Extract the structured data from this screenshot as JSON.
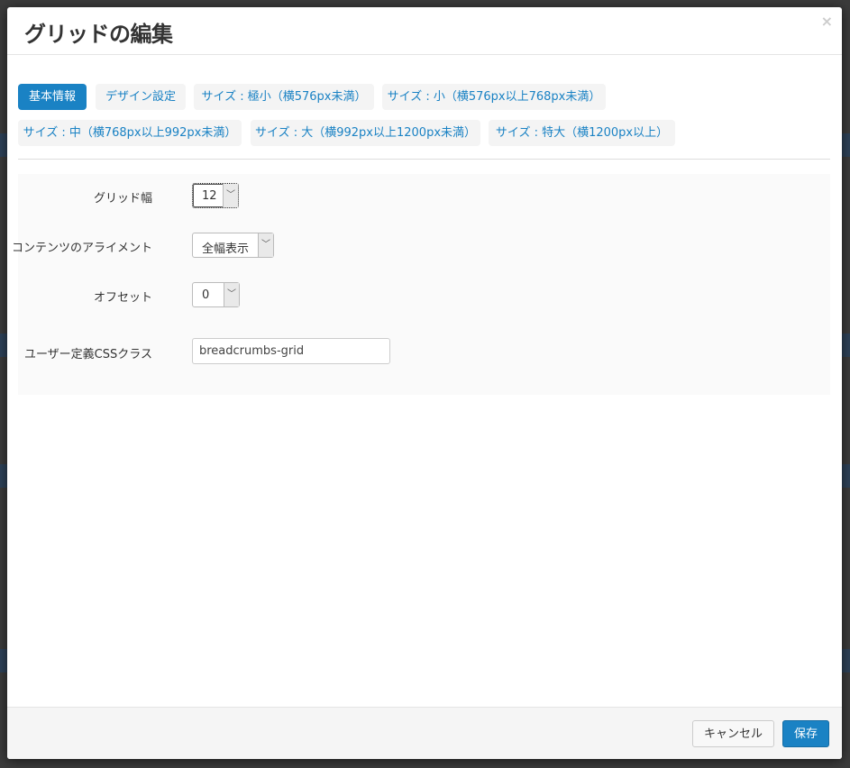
{
  "dialog": {
    "title": "グリッドの編集",
    "close_symbol": "×"
  },
  "tabs": [
    {
      "label": "基本情報",
      "active": true
    },
    {
      "label": "デザイン設定",
      "active": false
    },
    {
      "label": "サイズ : 極小（横576px未満）",
      "active": false
    },
    {
      "label": "サイズ : 小（横576px以上768px未満）",
      "active": false
    },
    {
      "label": "サイズ : 中（横768px以上992px未満）",
      "active": false
    },
    {
      "label": "サイズ : 大（横992px以上1200px未満）",
      "active": false
    },
    {
      "label": "サイズ : 特大（横1200px以上）",
      "active": false
    }
  ],
  "form": {
    "grid_width": {
      "label": "グリッド幅",
      "value": "12"
    },
    "alignment": {
      "label": "コンテンツのアライメント",
      "value": "全幅表示"
    },
    "offset": {
      "label": "オフセット",
      "value": "0"
    },
    "css_class": {
      "label": "ユーザー定義CSSクラス",
      "value": "breadcrumbs-grid"
    }
  },
  "footer": {
    "cancel_label": "キャンセル",
    "save_label": "保存"
  },
  "colors": {
    "accent": "#1a82c4",
    "tab_bg": "#f4f4f4",
    "backdrop": "#3b3b3b"
  },
  "icons": {
    "close": "close-icon",
    "select_arrow": "chevron-down-icon"
  }
}
